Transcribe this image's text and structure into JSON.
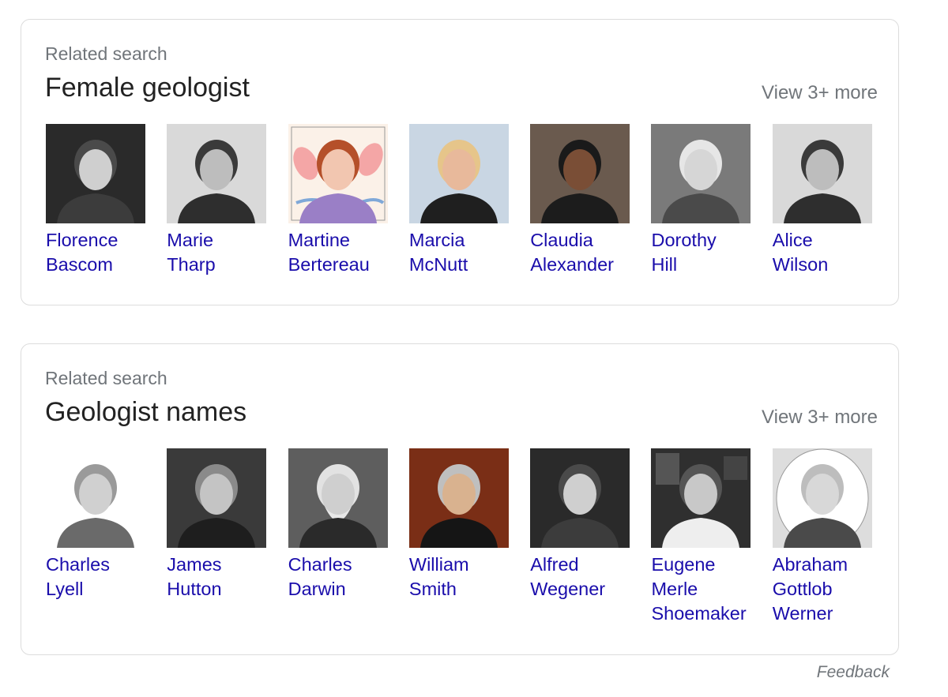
{
  "sections": [
    {
      "label": "Related search",
      "title": "Female geologist",
      "view_more": "View 3+ more",
      "people": [
        {
          "name_lines": [
            "Florence",
            "Bascom"
          ],
          "photo": "bw"
        },
        {
          "name_lines": [
            "Marie",
            "Tharp"
          ],
          "photo": "bw-light"
        },
        {
          "name_lines": [
            "Martine",
            "Bertereau"
          ],
          "photo": "illustration"
        },
        {
          "name_lines": [
            "Marcia",
            "McNutt"
          ],
          "photo": "color-blonde"
        },
        {
          "name_lines": [
            "Claudia",
            "Alexander"
          ],
          "photo": "color-dark"
        },
        {
          "name_lines": [
            "Dorothy",
            "Hill"
          ],
          "photo": "bw-glasses"
        },
        {
          "name_lines": [
            "Alice",
            "Wilson"
          ],
          "photo": "bw-light"
        }
      ]
    },
    {
      "label": "Related search",
      "title": "Geologist names",
      "view_more": "View 3+ more",
      "people": [
        {
          "name_lines": [
            "Charles",
            "Lyell"
          ],
          "photo": "engraving"
        },
        {
          "name_lines": [
            "James",
            "Hutton"
          ],
          "photo": "bw-dark"
        },
        {
          "name_lines": [
            "Charles",
            "Darwin"
          ],
          "photo": "bw-beard"
        },
        {
          "name_lines": [
            "William",
            "Smith"
          ],
          "photo": "painting"
        },
        {
          "name_lines": [
            "Alfred",
            "Wegener"
          ],
          "photo": "bw"
        },
        {
          "name_lines": [
            "Eugene",
            "Merle",
            "Shoemaker"
          ],
          "photo": "bw-office"
        },
        {
          "name_lines": [
            "Abraham",
            "Gottlob",
            "Werner"
          ],
          "photo": "engraving-oval"
        }
      ]
    }
  ],
  "feedback": "Feedback",
  "colors": {
    "link": "#1a0dab",
    "muted": "#70757a",
    "title": "#222222",
    "border": "#dcdcdc"
  }
}
